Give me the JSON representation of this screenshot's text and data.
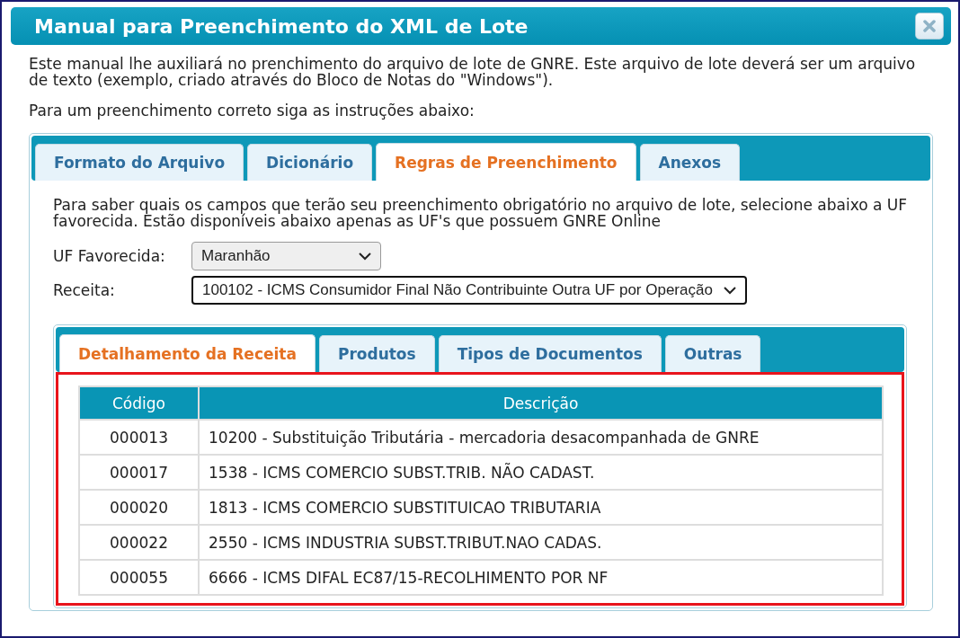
{
  "window": {
    "title": "Manual para Preenchimento do XML de Lote"
  },
  "intro": [
    "Este manual lhe auxiliará no prenchimento do arquivo de lote de GNRE. Este arquivo de lote deverá ser um arquivo de texto (exemplo, criado através do Bloco de Notas do \"Windows\").",
    "Para um preenchimento correto siga as instruções abaixo:"
  ],
  "tabs": [
    {
      "label": "Formato do Arquivo",
      "selected": false
    },
    {
      "label": "Dicionário",
      "selected": false
    },
    {
      "label": "Regras de Preenchimento",
      "selected": true
    },
    {
      "label": "Anexos",
      "selected": false
    }
  ],
  "rules_text": "Para saber quais os campos que terão seu preenchimento obrigatório no arquivo de lote, selecione abaixo a UF favorecida. Estão disponíveis abaixo apenas as UF's que possuem GNRE Online",
  "fields": [
    {
      "label": "UF Favorecida:",
      "value": "Maranhão",
      "focused": false
    },
    {
      "label": "Receita:",
      "value": "100102 - ICMS Consumidor Final Não Contribuinte Outra UF por Operação",
      "focused": true
    }
  ],
  "sub_tabs": [
    {
      "label": "Detalhamento da Receita",
      "selected": true
    },
    {
      "label": "Produtos",
      "selected": false
    },
    {
      "label": "Tipos de Documentos",
      "selected": false
    },
    {
      "label": "Outras",
      "selected": false
    }
  ],
  "table": {
    "columns": [
      "Código",
      "Descrição"
    ],
    "rows": [
      [
        "000013",
        "10200 - Substituição Tributária - mercadoria desacompanhada de GNRE"
      ],
      [
        "000017",
        "1538 - ICMS COMERCIO SUBST.TRIB. NÃO CADAST."
      ],
      [
        "000020",
        "1813 - ICMS COMERCIO SUBSTITUICAO TRIBUTARIA"
      ],
      [
        "000022",
        "2550 - ICMS INDUSTRIA SUBST.TRIBUT.NAO CADAS."
      ],
      [
        "000055",
        "6666 - ICMS DIFAL EC87/15-RECOLHIMENTO POR NF"
      ]
    ]
  }
}
